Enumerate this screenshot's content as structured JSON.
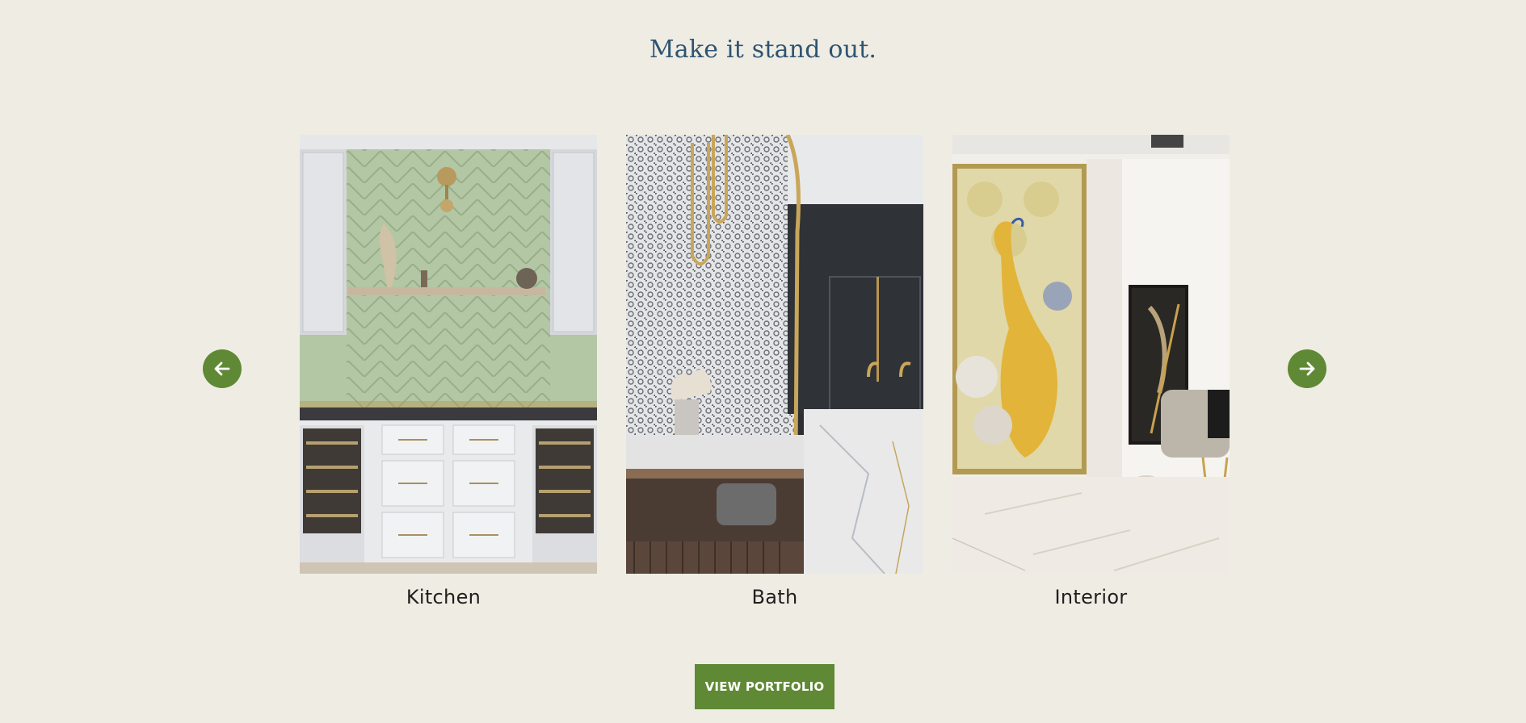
{
  "section": {
    "title": "Make it stand out."
  },
  "carousel": {
    "prev_icon": "arrow-left-icon",
    "next_icon": "arrow-right-icon",
    "items": [
      {
        "label": "Kitchen",
        "image": "kitchen-photo"
      },
      {
        "label": "Bath",
        "image": "bath-photo"
      },
      {
        "label": "Interior",
        "image": "interior-photo"
      }
    ]
  },
  "cta": {
    "label": "VIEW PORTFOLIO"
  },
  "colors": {
    "background": "#efede3",
    "accent": "#5f8935",
    "title": "#2f5472"
  }
}
